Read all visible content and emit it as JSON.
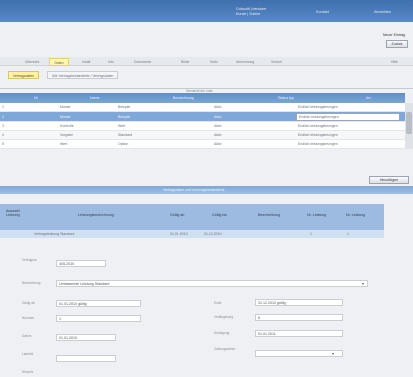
{
  "header": {
    "user_line1": "Crdaudit | benutzer",
    "user_line2": "Kunde | Zuletzt",
    "links": [
      "Kontakt",
      "Abmelden"
    ]
  },
  "actions": {
    "top_link": "Neuer Eintrag",
    "top_button": "Zurück"
  },
  "tabs": {
    "items": [
      "Übersicht",
      "Daten",
      "Inhalt",
      "Info",
      "Dokumente",
      "Bilder",
      "Notiz",
      "Abrechnung",
      "Verlauf"
    ],
    "right_label": "Hilfe"
  },
  "subtabs": [
    "Vertragsdaten",
    "Alle Vertragsbestandteile / Vertragsdaten"
  ],
  "table1": {
    "caption": "Übersicht der Liste",
    "columns": [
      "Nr",
      "Name",
      "Bezeichnung",
      "Status typ",
      "Art"
    ],
    "rows": [
      [
        "1",
        "Muster",
        "Beispiel",
        "Aktiv",
        "Endlich leistungsbezogen"
      ],
      [
        "2",
        "Muster",
        "Beispiel",
        "Aktiv",
        "Endlich leistungsbezogen"
      ],
      [
        "3",
        "Kontrolle",
        "Wert",
        "Aktiv",
        "Endlich leistungsbezogen"
      ],
      [
        "4",
        "Vorgabe",
        "Standard",
        "Aktiv",
        "Endlich leistungsbezogen"
      ],
      [
        "5",
        "Wert",
        "Option",
        "Aktiv",
        "Endlich leistungsbezogen"
      ]
    ],
    "button": "Hinzufügen"
  },
  "table2": {
    "caption": "Vertragsdaten und Leistungsbestandteile",
    "columns": [
      "Auswahl Leistung",
      "Leistungsbezeichnung",
      "Gültig ab",
      "Gültig bis",
      "Beschreibung",
      "Nr. Leistung",
      "Nr. Leistung"
    ],
    "row": [
      "",
      "Vertragsleistung Standard",
      "01.01.2010",
      "31.12.2010",
      "",
      "1",
      "1"
    ]
  },
  "form": {
    "fields": {
      "f1": {
        "label": "Vertragsnr.",
        "value": "405-2010"
      },
      "f2": {
        "label": "Bezeichnung",
        "value": "Umfassende Leistung Standard"
      },
      "f3": {
        "label": "Gültig ab",
        "value": "01.01.2010 gültig"
      },
      "f4": {
        "label": "Nummer",
        "value": "1"
      },
      "f5": {
        "label": "Datum",
        "value": "01.01.2010"
      },
      "f6": {
        "label": "Laufzeit",
        "value": ""
      },
      "r1": {
        "label": "Ende",
        "value": "31.12.2010 gültig"
      },
      "r2": {
        "label": "Verlängerung",
        "value": "6"
      },
      "r3": {
        "label": "Kündigung",
        "value": "01.01.2011"
      },
      "r4": {
        "label": "Zahlungsweise",
        "value": ""
      }
    },
    "bottom_label": "Hinweis"
  }
}
